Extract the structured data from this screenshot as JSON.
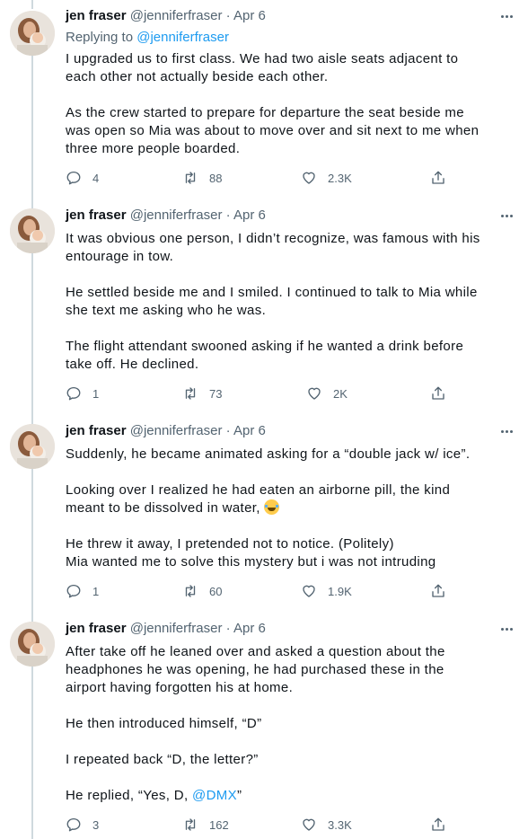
{
  "tweets": [
    {
      "name": "jen fraser",
      "handle": "@jenniferfraser",
      "dot": "·",
      "date": "Apr 6",
      "replying_prefix": "Replying to ",
      "replying_to": "@jenniferfraser",
      "paragraphs": [
        "I upgraded us to first class. We had two aisle seats adjacent to\neach other not actually beside each other.",
        "As the crew started to prepare for departure the seat beside me\nwas open so Mia was about to move over and sit next to me when\nthree more people boarded."
      ],
      "replies": "4",
      "retweets": "88",
      "likes": "2.3K"
    },
    {
      "name": "jen fraser",
      "handle": "@jenniferfraser",
      "dot": "·",
      "date": "Apr 6",
      "paragraphs": [
        "It was obvious one person, I didn’t recognize, was famous with his\nentourage in tow.",
        "He settled beside me and I smiled. I continued to talk to Mia while\nshe text me asking who he was.",
        "The flight attendant swooned asking if he wanted a drink before\ntake off. He declined."
      ],
      "replies": "1",
      "retweets": "73",
      "likes": "2K"
    },
    {
      "name": "jen fraser",
      "handle": "@jenniferfraser",
      "dot": "·",
      "date": "Apr 6",
      "paragraphs": [
        "Suddenly, he became animated asking for a “double jack w/ ice”.",
        "Looking over I realized he had eaten an airborne pill, the kind\nmeant to be dissolved in water,",
        "He threw it away, I pretended not to notice. (Politely)\nMia wanted me to solve this mystery but i was not intruding"
      ],
      "emoji_name": "face-with-tears-of-joy-icon",
      "replies": "1",
      "retweets": "60",
      "likes": "1.9K"
    },
    {
      "name": "jen fraser",
      "handle": "@jenniferfraser",
      "dot": "·",
      "date": "Apr 6",
      "paragraphs": [
        "After take off he leaned over and asked a question about the\nheadphones he was opening, he had purchased these in the\nairport having forgotten his at home.",
        "He then introduced himself, “D”",
        "I repeated back “D, the letter?”"
      ],
      "last_line_prefix": "He replied, “Yes, D, ",
      "last_line_mention": "@DMX",
      "last_line_suffix": "”",
      "replies": "3",
      "retweets": "162",
      "likes": "3.3K"
    }
  ],
  "colors": {
    "text": "#0f1419",
    "secondary": "#536471",
    "accent": "#1d9bf0",
    "thread_line": "#cfd9de"
  }
}
